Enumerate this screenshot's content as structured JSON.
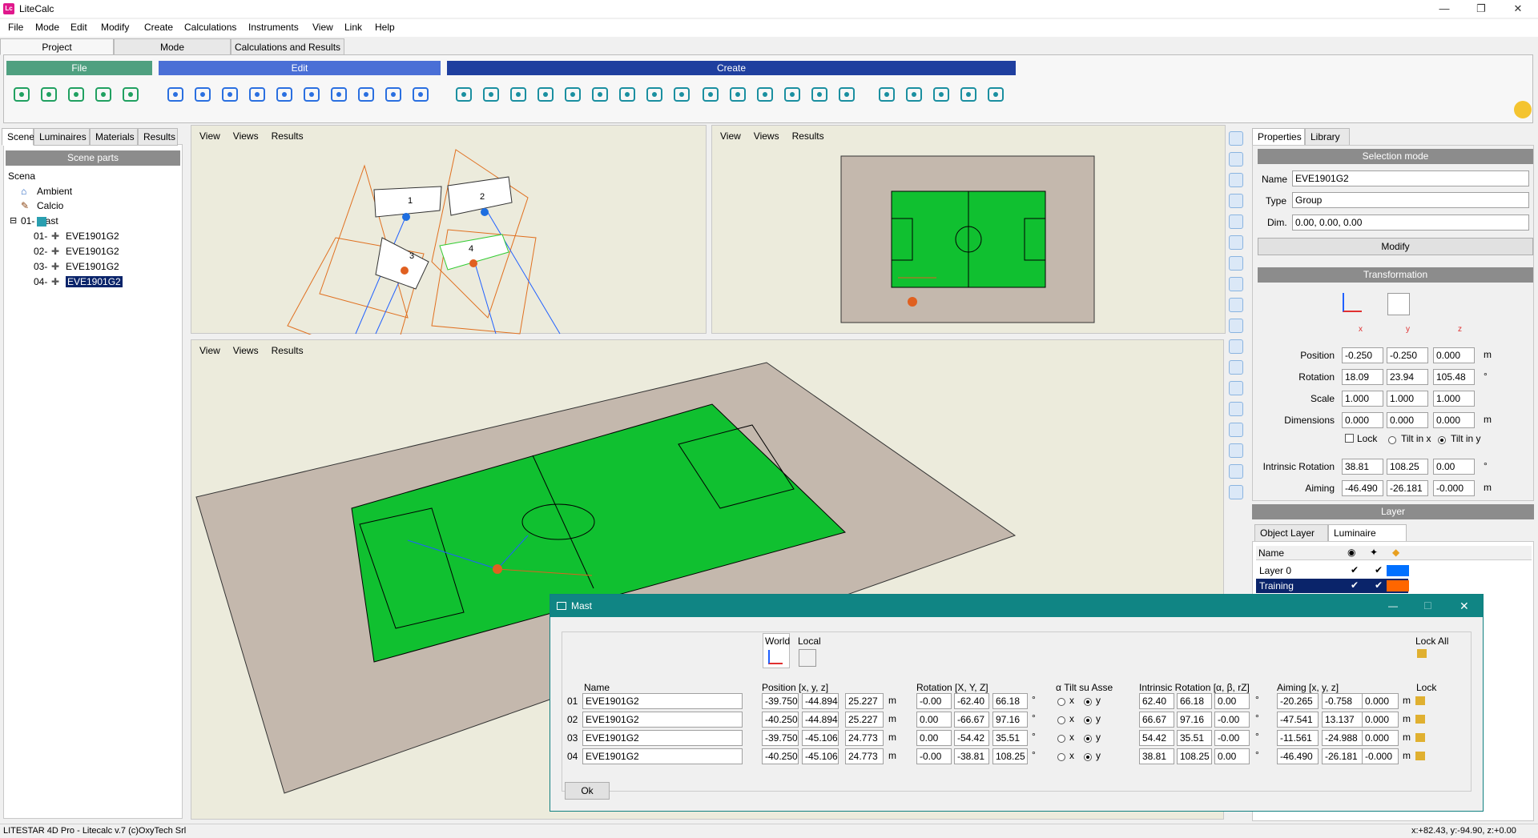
{
  "window": {
    "title": "LiteCalc",
    "icon_text": "Lc",
    "minimize": "—",
    "restore": "❐",
    "close": "✕"
  },
  "menu": [
    "File",
    "Mode",
    "Edit",
    "Modify",
    "Create",
    "Calculations",
    "Instruments",
    "View",
    "Link",
    "Help"
  ],
  "top_tabs": [
    "Project",
    "Mode",
    "Calculations and Results"
  ],
  "ribbon": {
    "groups": {
      "file": "File",
      "edit": "Edit",
      "create": "Create"
    },
    "file_tools": [
      "new-file-icon",
      "open-folder-icon",
      "save-icon",
      "print-icon",
      "pdf-icon"
    ],
    "edit_tools": [
      "select-points-icon",
      "line-tool-icon",
      "rectangle-select-icon",
      "polyline-icon",
      "grid-points-icon",
      "scissor-icon",
      "text-icon",
      "network-icon",
      "hierarchy-icon",
      "pattern-icon"
    ],
    "create_tools": [
      "house-icon",
      "house-outline-icon",
      "building-icon",
      "landscape-icon",
      "sphere-icon",
      "road-icon",
      "ramp-icon",
      "arch-icon",
      "tunnel-icon",
      "info-icon",
      "tower-icon",
      "table-icon",
      "table2-icon",
      "pole-icon",
      "field-icon",
      "dots-grid-icon",
      "ring-dots-icon",
      "line-dots-icon",
      "scatter-dots-icon",
      "grid-array-icon"
    ],
    "user_icon": "user-icon"
  },
  "left_panel": {
    "tabs": [
      "Scene",
      "Luminaires",
      "Materials",
      "Results"
    ],
    "header": "Scene parts",
    "tree": {
      "root": "Scena",
      "ambient": "Ambient",
      "calcio": "Calcio",
      "mast": "01- Mast",
      "items": [
        {
          "idx": "01-",
          "name": "EVE1901G2"
        },
        {
          "idx": "02-",
          "name": "EVE1901G2"
        },
        {
          "idx": "03-",
          "name": "EVE1901G2"
        },
        {
          "idx": "04-",
          "name": "EVE1901G2"
        }
      ],
      "expander": "⊟"
    }
  },
  "viewport_menu": {
    "view": "View",
    "views": "Views",
    "results": "Results"
  },
  "scene_labels": {
    "l1": "1",
    "l2": "2",
    "l3": "3",
    "l4": "4"
  },
  "right_panel": {
    "tabs": [
      "Properties",
      "Library"
    ],
    "selection_mode": "Selection mode",
    "name_label": "Name",
    "name": "EVE1901G2",
    "type_label": "Type",
    "type": "Group",
    "dim_label": "Dim.",
    "dim": "0.00, 0.00, 0.00",
    "modify": "Modify",
    "transformation": "Transformation",
    "axes": {
      "x": "x",
      "y": "y",
      "z": "z"
    },
    "position_label": "Position",
    "position": [
      "-0.250",
      "-0.250",
      "0.000"
    ],
    "position_unit": "m",
    "rotation_label": "Rotation",
    "rotation": [
      "18.09",
      "23.94",
      "105.48"
    ],
    "rotation_unit": "°",
    "scale_label": "Scale",
    "scale": [
      "1.000",
      "1.000",
      "1.000"
    ],
    "dimensions_label": "Dimensions",
    "dimensions": [
      "0.000",
      "0.000",
      "0.000"
    ],
    "dimensions_unit": "m",
    "lock": "Lock",
    "tilt_x": "Tilt in x",
    "tilt_y": "Tilt in y",
    "intrinsic_label": "Intrinsic Rotation",
    "intrinsic": [
      "38.81",
      "108.25",
      "0.00"
    ],
    "intrinsic_unit": "°",
    "aiming_label": "Aiming",
    "aiming": [
      "-46.490",
      "-26.181",
      "-0.000"
    ],
    "aiming_unit": "m",
    "layer_header": "Layer",
    "layer_tabs": [
      "Object Layer",
      "Luminaire Layer"
    ],
    "layer_col_name": "Name",
    "layers": [
      {
        "name": "Layer 0",
        "color": "#0070ff"
      },
      {
        "name": "Training",
        "color": "#ff6600"
      }
    ],
    "check": "✔"
  },
  "dialog": {
    "title": "Mast",
    "world": "World",
    "local": "Local",
    "lock_all": "Lock All",
    "headers": {
      "name": "Name",
      "position": "Position  [x, y, z]",
      "rotation": "Rotation  [X, Y, Z]",
      "tilt": "α Tilt su Asse",
      "intrinsic": "Intrinsic Rotation  [α, β, rZ]",
      "aiming": "Aiming  [x, y, z]",
      "lock": "Lock"
    },
    "unit_m": "m",
    "unit_deg": "°",
    "x": "x",
    "y": "y",
    "rows": [
      {
        "idx": "01",
        "name": "EVE1901G2",
        "pos": [
          "-39.750",
          "-44.894",
          "25.227"
        ],
        "rot": [
          "-0.00",
          "-62.40",
          "66.18"
        ],
        "intr": [
          "62.40",
          "66.18",
          "0.00"
        ],
        "aim": [
          "-20.265",
          "-0.758",
          "0.000"
        ]
      },
      {
        "idx": "02",
        "name": "EVE1901G2",
        "pos": [
          "-40.250",
          "-44.894",
          "25.227"
        ],
        "rot": [
          "0.00",
          "-66.67",
          "97.16"
        ],
        "intr": [
          "66.67",
          "97.16",
          "-0.00"
        ],
        "aim": [
          "-47.541",
          "13.137",
          "0.000"
        ]
      },
      {
        "idx": "03",
        "name": "EVE1901G2",
        "pos": [
          "-39.750",
          "-45.106",
          "24.773"
        ],
        "rot": [
          "0.00",
          "-54.42",
          "35.51"
        ],
        "intr": [
          "54.42",
          "35.51",
          "-0.00"
        ],
        "aim": [
          "-11.561",
          "-24.988",
          "0.000"
        ]
      },
      {
        "idx": "04",
        "name": "EVE1901G2",
        "pos": [
          "-40.250",
          "-45.106",
          "24.773"
        ],
        "rot": [
          "-0.00",
          "-38.81",
          "108.25"
        ],
        "intr": [
          "38.81",
          "108.25",
          "0.00"
        ],
        "aim": [
          "-46.490",
          "-26.181",
          "-0.000"
        ]
      }
    ],
    "ok": "Ok"
  },
  "status": {
    "left": "LITESTAR 4D Pro - Litecalc v.7    (c)OxyTech Srl",
    "right": "x:+82.43, y:-94.90, z:+0.00"
  },
  "colors": {
    "file_group": "#4fa080",
    "edit_group": "#4a6fd6",
    "create_group": "#1f3f9f",
    "pitch": "#10c030",
    "dialog_title": "#108584",
    "selection": "#0a246a"
  }
}
